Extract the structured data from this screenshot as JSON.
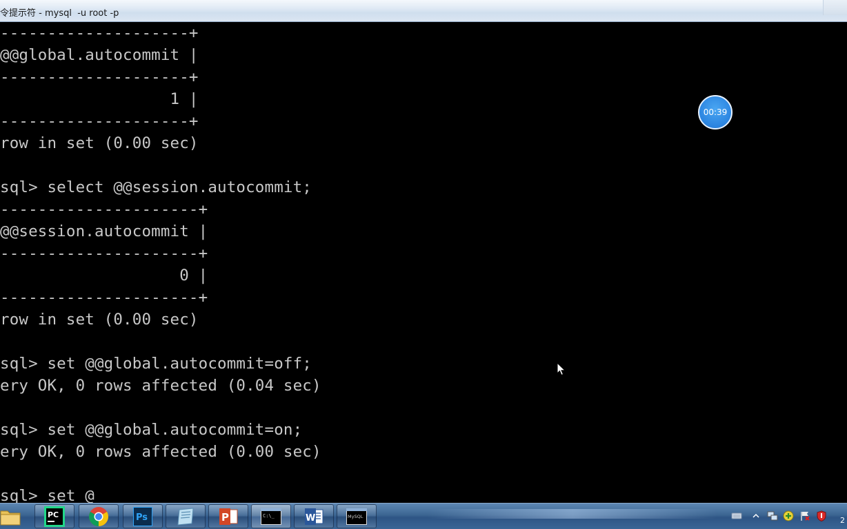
{
  "window": {
    "title": "令提示符 - mysql  -u root -p"
  },
  "console": {
    "lines": [
      "--------------------+",
      "@@global.autocommit |",
      "--------------------+",
      "                  1 |",
      "--------------------+",
      "row in set (0.00 sec)",
      "",
      "sql> select @@session.autocommit;",
      "---------------------+",
      "@@session.autocommit |",
      "---------------------+",
      "                   0 |",
      "---------------------+",
      "row in set (0.00 sec)",
      "",
      "sql> set @@global.autocommit=off;",
      "ery OK, 0 rows affected (0.04 sec)",
      "",
      "sql> set @@global.autocommit=on;",
      "ery OK, 0 rows affected (0.00 sec)",
      "",
      "sql> set @"
    ]
  },
  "timer": {
    "value": "00:39"
  },
  "taskbar": {
    "apps": [
      {
        "name": "file-explorer",
        "label": ""
      },
      {
        "name": "pycharm",
        "label": "PC"
      },
      {
        "name": "chrome",
        "label": ""
      },
      {
        "name": "photoshop",
        "label": "Ps"
      },
      {
        "name": "notepad",
        "label": ""
      },
      {
        "name": "powerpoint",
        "label": "P"
      },
      {
        "name": "cmd",
        "label": "C:\\_"
      },
      {
        "name": "word",
        "label": "W"
      },
      {
        "name": "mysql-client",
        "label": "MySQL"
      }
    ],
    "clock_fragment": "2"
  },
  "colors": {
    "console_bg": "#000000",
    "console_text": "#c8c8c8",
    "timer_bg": "#2b84e0",
    "taskbar": "#3c6592"
  }
}
